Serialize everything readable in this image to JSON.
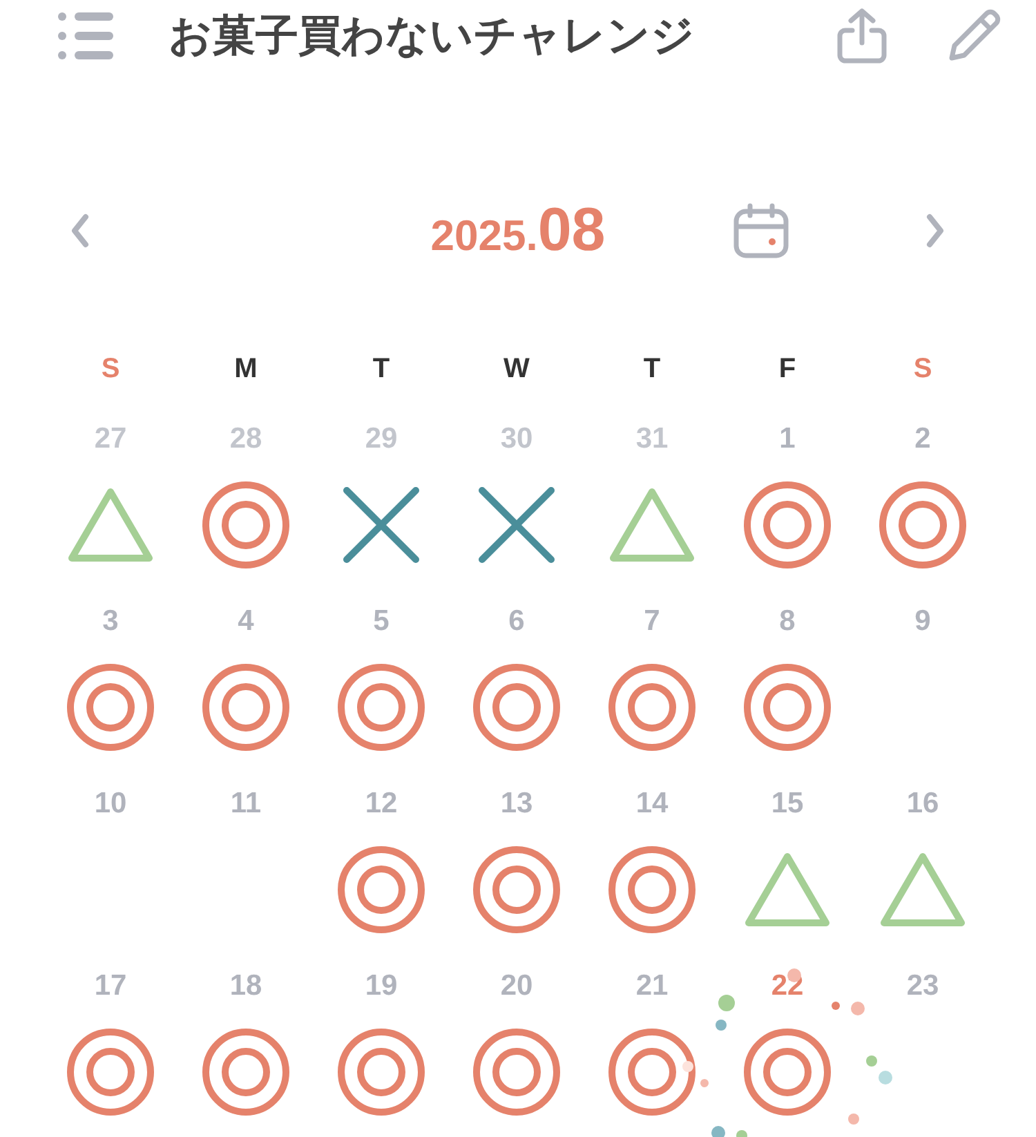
{
  "header": {
    "title": "お菓子買わないチャレンジ"
  },
  "month": {
    "year": "2025.",
    "month": "08"
  },
  "weekdays": [
    {
      "label": "S",
      "weekend": true
    },
    {
      "label": "M",
      "weekend": false
    },
    {
      "label": "T",
      "weekend": false
    },
    {
      "label": "W",
      "weekend": false
    },
    {
      "label": "T",
      "weekend": false
    },
    {
      "label": "F",
      "weekend": false
    },
    {
      "label": "S",
      "weekend": true
    }
  ],
  "weeks": [
    [
      {
        "day": "27",
        "outside": true,
        "today": false,
        "kind": "triangle"
      },
      {
        "day": "28",
        "outside": true,
        "today": false,
        "kind": "circle"
      },
      {
        "day": "29",
        "outside": true,
        "today": false,
        "kind": "cross"
      },
      {
        "day": "30",
        "outside": true,
        "today": false,
        "kind": "cross"
      },
      {
        "day": "31",
        "outside": true,
        "today": false,
        "kind": "triangle"
      },
      {
        "day": "1",
        "outside": false,
        "today": false,
        "kind": "circle"
      },
      {
        "day": "2",
        "outside": false,
        "today": false,
        "kind": "circle"
      }
    ],
    [
      {
        "day": "3",
        "outside": false,
        "today": false,
        "kind": "circle"
      },
      {
        "day": "4",
        "outside": false,
        "today": false,
        "kind": "circle"
      },
      {
        "day": "5",
        "outside": false,
        "today": false,
        "kind": "circle"
      },
      {
        "day": "6",
        "outside": false,
        "today": false,
        "kind": "circle"
      },
      {
        "day": "7",
        "outside": false,
        "today": false,
        "kind": "circle"
      },
      {
        "day": "8",
        "outside": false,
        "today": false,
        "kind": "circle"
      },
      {
        "day": "9",
        "outside": false,
        "today": false,
        "kind": "empty"
      }
    ],
    [
      {
        "day": "10",
        "outside": false,
        "today": false,
        "kind": "empty"
      },
      {
        "day": "11",
        "outside": false,
        "today": false,
        "kind": "empty"
      },
      {
        "day": "12",
        "outside": false,
        "today": false,
        "kind": "circle"
      },
      {
        "day": "13",
        "outside": false,
        "today": false,
        "kind": "circle"
      },
      {
        "day": "14",
        "outside": false,
        "today": false,
        "kind": "circle"
      },
      {
        "day": "15",
        "outside": false,
        "today": false,
        "kind": "triangle"
      },
      {
        "day": "16",
        "outside": false,
        "today": false,
        "kind": "triangle"
      }
    ],
    [
      {
        "day": "17",
        "outside": false,
        "today": false,
        "kind": "circle"
      },
      {
        "day": "18",
        "outside": false,
        "today": false,
        "kind": "circle"
      },
      {
        "day": "19",
        "outside": false,
        "today": false,
        "kind": "circle"
      },
      {
        "day": "20",
        "outside": false,
        "today": false,
        "kind": "circle"
      },
      {
        "day": "21",
        "outside": false,
        "today": false,
        "kind": "circle"
      },
      {
        "day": "22",
        "outside": false,
        "today": true,
        "kind": "circle"
      },
      {
        "day": "23",
        "outside": false,
        "today": false,
        "kind": "empty"
      }
    ]
  ]
}
